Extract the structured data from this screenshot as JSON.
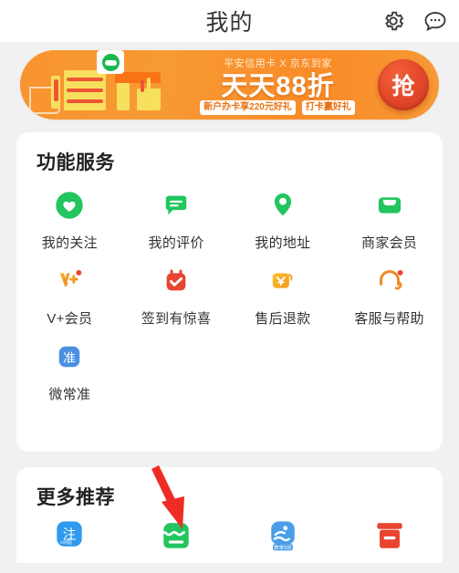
{
  "header": {
    "title": "我的",
    "settings_icon": "gear-icon",
    "message_icon": "chat-bubble-icon"
  },
  "banner": {
    "subtitle": "平安信用卡 X 京东到家",
    "headline": "天天88折",
    "tags": [
      "新户办卡享220元好礼",
      "打卡赢好礼"
    ],
    "cta_label": "抢",
    "background_color": "#f8942f",
    "cta_color": "#e2472a"
  },
  "services": {
    "title": "功能服务",
    "items": [
      {
        "label": "我的关注",
        "icon": "heart-circle-icon",
        "color": "#22c55e"
      },
      {
        "label": "我的评价",
        "icon": "comment-icon",
        "color": "#22c55e"
      },
      {
        "label": "我的地址",
        "icon": "location-pin-icon",
        "color": "#22c55e"
      },
      {
        "label": "商家会员",
        "icon": "membership-card-icon",
        "color": "#22c55e"
      },
      {
        "label": "V+会员",
        "icon": "v-plus-icon",
        "color": "#f5a623"
      },
      {
        "label": "签到有惊喜",
        "icon": "calendar-check-icon",
        "color": "#e8442f"
      },
      {
        "label": "售后退款",
        "icon": "yen-refund-icon",
        "color": "#f5b024"
      },
      {
        "label": "客服与帮助",
        "icon": "headset-icon",
        "color": "#f08a24"
      },
      {
        "label": "微常准",
        "icon": "wei-chang-zhun-icon",
        "color": "#4a90e2"
      }
    ]
  },
  "more": {
    "title": "更多推荐",
    "items": [
      {
        "label": "",
        "icon": "zhu-app-icon",
        "color": "#2f9bf0",
        "glyph": "注"
      },
      {
        "label": "",
        "icon": "shop-icon",
        "color": "#22c55e",
        "glyph": ""
      },
      {
        "label": "",
        "icon": "swim-badge-icon",
        "color": "#4a9eea",
        "glyph": "",
        "badge": "首单5折"
      },
      {
        "label": "",
        "icon": "gift-box-icon",
        "color": "#e8442f",
        "glyph": ""
      }
    ]
  },
  "annotation": {
    "arrow": "red-arrow-pointing-to-shop-icon",
    "color": "#ee2b24"
  }
}
